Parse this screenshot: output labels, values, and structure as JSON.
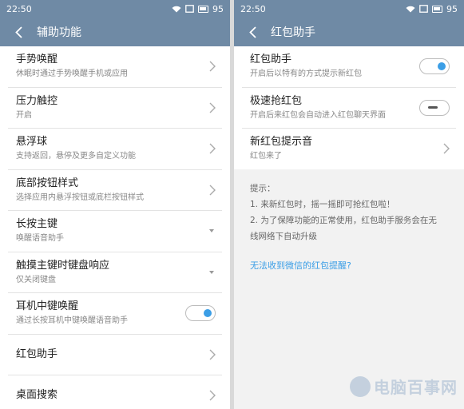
{
  "left": {
    "status": {
      "time": "22:50",
      "battery": "95"
    },
    "title": "辅助功能",
    "items": [
      {
        "label": "手势唤醒",
        "sub": "休眠时通过手势唤醒手机或应用"
      },
      {
        "label": "压力触控",
        "sub": "开启"
      },
      {
        "label": "悬浮球",
        "sub": "支持返回，悬停及更多自定义功能"
      },
      {
        "label": "底部按钮样式",
        "sub": "选择应用内悬浮按钮或底栏按钮样式"
      },
      {
        "label": "长按主键",
        "sub": "唤醒语音助手"
      },
      {
        "label": "触摸主键时键盘响应",
        "sub": "仅关闭键盘"
      },
      {
        "label": "耳机中键唤醒",
        "sub": "通过长按耳机中键唤醒语音助手"
      },
      {
        "label": "红包助手"
      },
      {
        "label": "桌面搜索"
      }
    ]
  },
  "right": {
    "status": {
      "time": "22:50",
      "battery": "95"
    },
    "title": "红包助手",
    "items": [
      {
        "label": "红包助手",
        "sub": "开启后以特有的方式提示新红包"
      },
      {
        "label": "极速抢红包",
        "sub": "开启后来红包会自动进入红包聊天界面"
      },
      {
        "label": "新红包提示音",
        "sub": "红包来了"
      }
    ],
    "tips": [
      "提示：",
      "1. 来新红包时，摇一摇即可抢红包啦！",
      "2. 为了保障功能的正常使用，红包助手服务会在无",
      "线网络下自动升级"
    ],
    "link": "无法收到微信的红包提醒?"
  },
  "watermark": "电脑百事网",
  "colors": {
    "header": "#6f8aa5",
    "accent": "#3b9ee6",
    "background": "#f2f2f2"
  },
  "toggles": {
    "earphone_wake": true,
    "hongbao_assistant": true,
    "fast_grab": false
  }
}
